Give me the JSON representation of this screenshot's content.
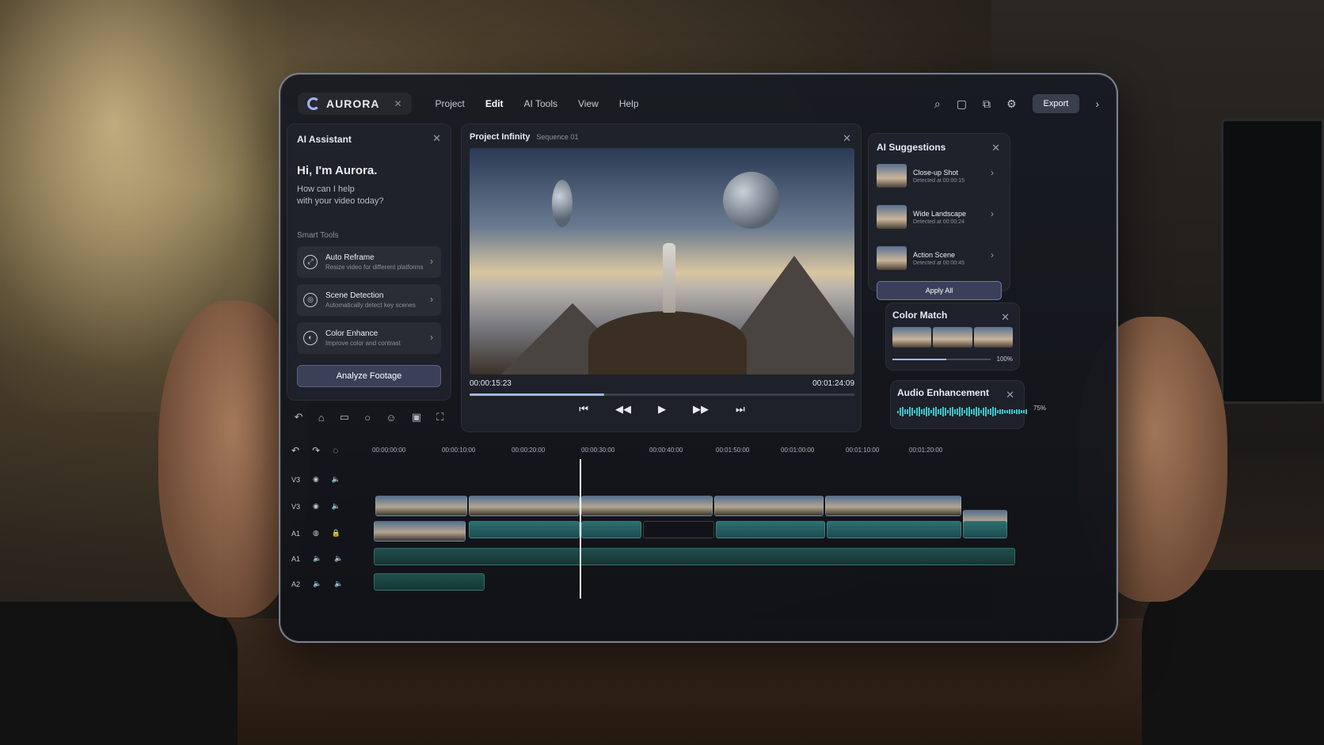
{
  "app": {
    "brand": "AURORA",
    "menu": [
      "Project",
      "Edit",
      "AI Tools",
      "View",
      "Help"
    ],
    "active_menu": "Edit",
    "export_label": "Export"
  },
  "ai_assistant": {
    "title": "AI Assistant",
    "greeting": "Hi, I'm Aurora.",
    "subline1": "How can I help",
    "subline2": "with your video today?",
    "section_label": "Smart Tools",
    "tools": [
      {
        "name": "Auto Reframe",
        "desc": "Resize video for different platforms"
      },
      {
        "name": "Scene Detection",
        "desc": "Automatically detect key scenes"
      },
      {
        "name": "Color Enhance",
        "desc": "Improve color and contrast"
      }
    ],
    "action": "Analyze Footage"
  },
  "viewer": {
    "project": "Project Infinity",
    "sequence": "Sequence 01",
    "current_time": "00:00:15:23",
    "total_time": "00:01:24:09",
    "progress": 0.35
  },
  "suggestions": {
    "title": "AI Suggestions",
    "items": [
      {
        "name": "Close-up Shot",
        "time": "Detected at 00:00:15"
      },
      {
        "name": "Wide Landscape",
        "time": "Detected at 00:00:24"
      },
      {
        "name": "Action Scene",
        "time": "Detected at 00:00:45"
      }
    ],
    "apply_label": "Apply All"
  },
  "color_match": {
    "title": "Color Match",
    "value_label": "100%",
    "level": 0.55
  },
  "audio_enhancement": {
    "title": "Audio Enhancement",
    "value_label": "75%",
    "level": 0.75
  },
  "timeline": {
    "ruler": [
      "00:00:00:00",
      "00:00:10:00",
      "00:00:20:00",
      "00:00:30:00",
      "00:00:40:00",
      "00:01:50:00",
      "00:01:00:00",
      "00:01:10:00",
      "00:01:20:00"
    ],
    "tracks": [
      "V3",
      "V3",
      "A1",
      "A1",
      "A2"
    ]
  },
  "colors": {
    "accent": "#9fb4ff",
    "audio": "#3fc4c9",
    "panel": "#20232b"
  }
}
